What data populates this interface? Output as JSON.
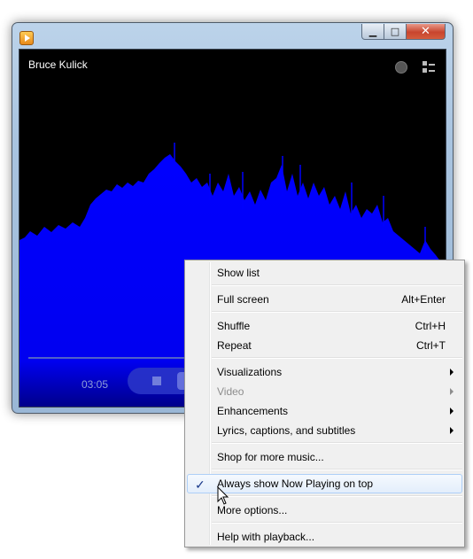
{
  "window": {
    "title": "Bruce Kulick",
    "time_elapsed": "03:05",
    "caption_buttons": {
      "minimize": "▁",
      "maximize": "□",
      "close": "✕"
    },
    "icons": [
      "app-icon",
      "now-playing-icon",
      "switch-to-library-icon",
      "stop-icon",
      "play-pause-icon"
    ]
  },
  "menu": {
    "items": [
      {
        "label": "Show list"
      },
      {
        "label": "Full screen",
        "shortcut": "Alt+Enter"
      },
      {
        "label": "Shuffle",
        "shortcut": "Ctrl+H"
      },
      {
        "label": "Repeat",
        "shortcut": "Ctrl+T"
      },
      {
        "label": "Visualizations",
        "submenu": true
      },
      {
        "label": "Video",
        "submenu": true,
        "disabled": true
      },
      {
        "label": "Enhancements",
        "submenu": true
      },
      {
        "label": "Lyrics, captions, and subtitles",
        "submenu": true
      },
      {
        "label": "Shop for more music..."
      },
      {
        "label": "Always show Now Playing on top",
        "checked": true,
        "check_mark": "✓",
        "highlighted": true
      },
      {
        "label": "More options..."
      },
      {
        "label": "Help with playback..."
      }
    ]
  },
  "colors": {
    "visualization": "#0000ff",
    "background": "#000000",
    "highlight_border": "#aecff7"
  }
}
